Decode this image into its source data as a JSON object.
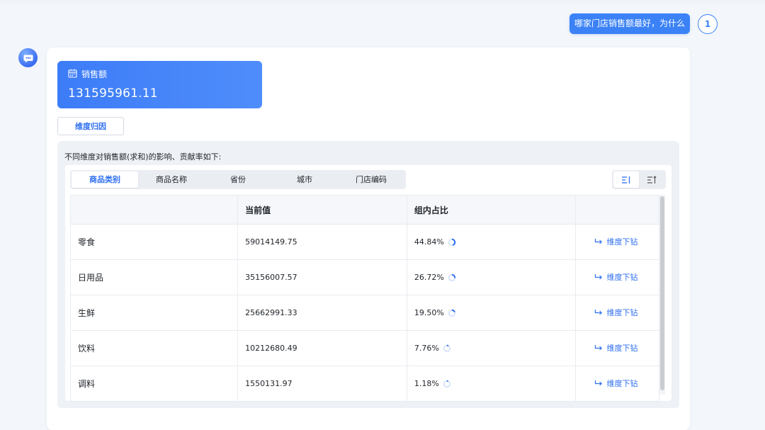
{
  "question": {
    "text": "哪家门店销售额最好，为什么",
    "avatar_text": "1"
  },
  "metric": {
    "label": "销售额",
    "value": "131595961.11"
  },
  "dim_button": "维度归因",
  "panel": {
    "description": "不同维度对销售额(求和)的影响、贡献率如下:"
  },
  "tabs": [
    {
      "label": "商品类别",
      "active": true
    },
    {
      "label": "商品名称",
      "active": false
    },
    {
      "label": "省份",
      "active": false
    },
    {
      "label": "城市",
      "active": false
    },
    {
      "label": "门店编码",
      "active": false
    }
  ],
  "table": {
    "headers": [
      "",
      "当前值",
      "组内占比",
      ""
    ],
    "drill_label": "维度下钻",
    "rows": [
      {
        "name": "零食",
        "value": "59014149.75",
        "share": "44.84%",
        "share_frac": 0.4484
      },
      {
        "name": "日用品",
        "value": "35156007.57",
        "share": "26.72%",
        "share_frac": 0.2672
      },
      {
        "name": "生鲜",
        "value": "25662991.33",
        "share": "19.50%",
        "share_frac": 0.195
      },
      {
        "name": "饮料",
        "value": "10212680.49",
        "share": "7.76%",
        "share_frac": 0.0776
      },
      {
        "name": "调料",
        "value": "1550131.97",
        "share": "1.18%",
        "share_frac": 0.0118
      }
    ]
  },
  "colors": {
    "accent": "#2f6ff0",
    "primary": "#3b82f6"
  }
}
